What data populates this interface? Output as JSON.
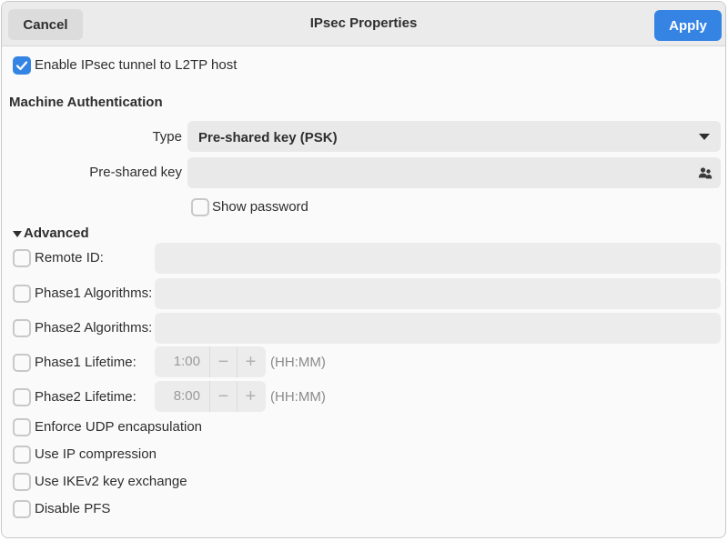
{
  "header": {
    "title": "IPsec Properties",
    "cancel_label": "Cancel",
    "apply_label": "Apply",
    "accent_color": "#3584e4"
  },
  "enable_tunnel": {
    "label": "Enable IPsec tunnel to L2TP host",
    "checked": true
  },
  "machine_auth": {
    "heading": "Machine Authentication",
    "type_label": "Type",
    "type_value": "Pre-shared key (PSK)",
    "psk_label": "Pre-shared key",
    "psk_value": "",
    "psk_icon": "user-group-icon",
    "show_password_label": "Show password",
    "show_password_checked": false
  },
  "advanced": {
    "heading": "Advanced",
    "expanded": true,
    "remote_id": {
      "label": "Remote ID:",
      "checked": false,
      "value": ""
    },
    "phase1_algorithms": {
      "label": "Phase1 Algorithms:",
      "checked": false,
      "value": ""
    },
    "phase2_algorithms": {
      "label": "Phase2 Algorithms:",
      "checked": false,
      "value": ""
    },
    "phase1_lifetime": {
      "label": "Phase1 Lifetime:",
      "checked": false,
      "value": "1:00",
      "unit": "(HH:MM)"
    },
    "phase2_lifetime": {
      "label": "Phase2 Lifetime:",
      "checked": false,
      "value": "8:00",
      "unit": "(HH:MM)"
    },
    "enforce_udp": {
      "label": "Enforce UDP encapsulation",
      "checked": false
    },
    "ip_compression": {
      "label": "Use IP compression",
      "checked": false
    },
    "ikev2": {
      "label": "Use IKEv2 key exchange",
      "checked": false
    },
    "disable_pfs": {
      "label": "Disable PFS",
      "checked": false
    }
  },
  "spin_symbols": {
    "minus": "−",
    "plus": "+"
  }
}
